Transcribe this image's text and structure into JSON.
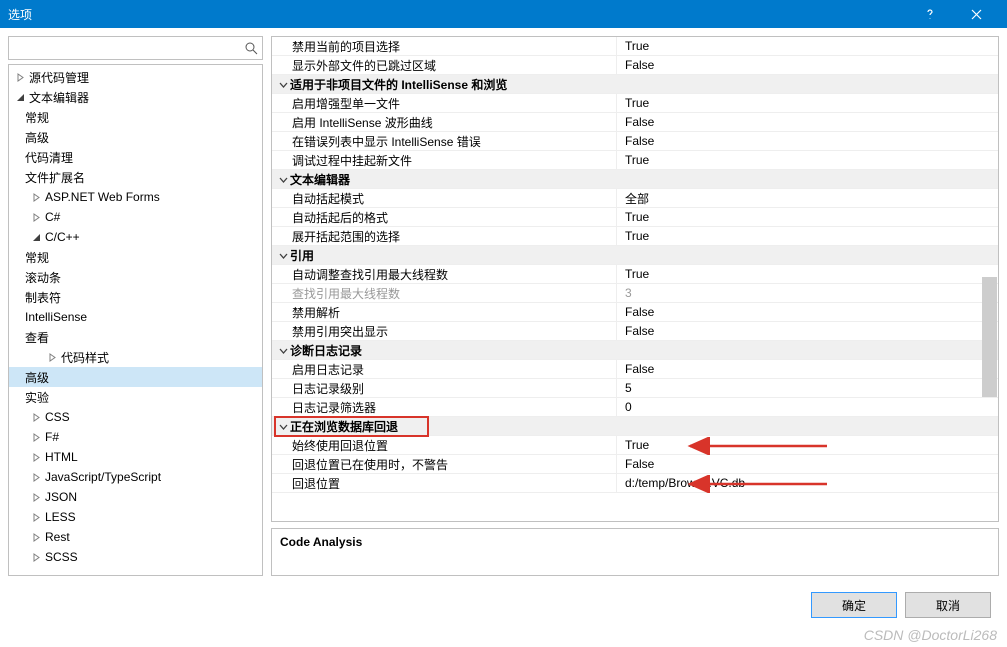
{
  "title": "选项",
  "search": {
    "placeholder": ""
  },
  "tree": [
    {
      "label": "源代码管理",
      "indent": 0,
      "exp": "closed"
    },
    {
      "label": "文本编辑器",
      "indent": 0,
      "exp": "open"
    },
    {
      "label": "常规",
      "indent": 1,
      "exp": "none"
    },
    {
      "label": "高级",
      "indent": 1,
      "exp": "none"
    },
    {
      "label": "代码清理",
      "indent": 1,
      "exp": "none"
    },
    {
      "label": "文件扩展名",
      "indent": 1,
      "exp": "none"
    },
    {
      "label": "ASP.NET Web Forms",
      "indent": 1,
      "exp": "closed"
    },
    {
      "label": "C#",
      "indent": 1,
      "exp": "closed"
    },
    {
      "label": "C/C++",
      "indent": 1,
      "exp": "open"
    },
    {
      "label": "常规",
      "indent": 2,
      "exp": "none"
    },
    {
      "label": "滚动条",
      "indent": 2,
      "exp": "none"
    },
    {
      "label": "制表符",
      "indent": 2,
      "exp": "none"
    },
    {
      "label": "IntelliSense",
      "indent": 2,
      "exp": "none"
    },
    {
      "label": "查看",
      "indent": 2,
      "exp": "none"
    },
    {
      "label": "代码样式",
      "indent": 2,
      "exp": "closed"
    },
    {
      "label": "高级",
      "indent": 2,
      "exp": "none",
      "selected": true
    },
    {
      "label": "实验",
      "indent": 2,
      "exp": "none"
    },
    {
      "label": "CSS",
      "indent": 1,
      "exp": "closed"
    },
    {
      "label": "F#",
      "indent": 1,
      "exp": "closed"
    },
    {
      "label": "HTML",
      "indent": 1,
      "exp": "closed"
    },
    {
      "label": "JavaScript/TypeScript",
      "indent": 1,
      "exp": "closed"
    },
    {
      "label": "JSON",
      "indent": 1,
      "exp": "closed"
    },
    {
      "label": "LESS",
      "indent": 1,
      "exp": "closed"
    },
    {
      "label": "Rest",
      "indent": 1,
      "exp": "closed"
    },
    {
      "label": "SCSS",
      "indent": 1,
      "exp": "closed"
    }
  ],
  "props": [
    {
      "type": "prop",
      "key": "禁用当前的项目选择",
      "val": "True"
    },
    {
      "type": "prop",
      "key": "显示外部文件的已跳过区域",
      "val": "False"
    },
    {
      "type": "cat",
      "key": "适用于非项目文件的 IntelliSense 和浏览"
    },
    {
      "type": "prop",
      "key": "启用增强型单一文件",
      "val": "True"
    },
    {
      "type": "prop",
      "key": "启用 IntelliSense 波形曲线",
      "val": "False"
    },
    {
      "type": "prop",
      "key": "在错误列表中显示 IntelliSense 错误",
      "val": "False"
    },
    {
      "type": "prop",
      "key": "调试过程中挂起新文件",
      "val": "True"
    },
    {
      "type": "cat",
      "key": "文本编辑器"
    },
    {
      "type": "prop",
      "key": "自动括起模式",
      "val": "全部"
    },
    {
      "type": "prop",
      "key": "自动括起后的格式",
      "val": "True"
    },
    {
      "type": "prop",
      "key": "展开括起范围的选择",
      "val": "True"
    },
    {
      "type": "cat",
      "key": "引用"
    },
    {
      "type": "prop",
      "key": "自动调整查找引用最大线程数",
      "val": "True"
    },
    {
      "type": "prop",
      "key": "查找引用最大线程数",
      "val": "3",
      "disabled": true
    },
    {
      "type": "prop",
      "key": "禁用解析",
      "val": "False"
    },
    {
      "type": "prop",
      "key": "禁用引用突出显示",
      "val": "False"
    },
    {
      "type": "cat",
      "key": "诊断日志记录"
    },
    {
      "type": "prop",
      "key": "启用日志记录",
      "val": "False"
    },
    {
      "type": "prop",
      "key": "日志记录级别",
      "val": "5"
    },
    {
      "type": "prop",
      "key": "日志记录筛选器",
      "val": "0"
    },
    {
      "type": "cat",
      "key": "正在浏览数据库回退",
      "highlight": true
    },
    {
      "type": "prop",
      "key": "始终使用回退位置",
      "val": "True",
      "arrow": true
    },
    {
      "type": "prop",
      "key": "回退位置已在使用时，不警告",
      "val": "False"
    },
    {
      "type": "prop",
      "key": "回退位置",
      "val": "d:/temp/Browse.VC.db",
      "arrow": true
    }
  ],
  "desc": {
    "title": "Code Analysis"
  },
  "buttons": {
    "ok": "确定",
    "cancel": "取消"
  },
  "watermark": "CSDN @DoctorLi268"
}
